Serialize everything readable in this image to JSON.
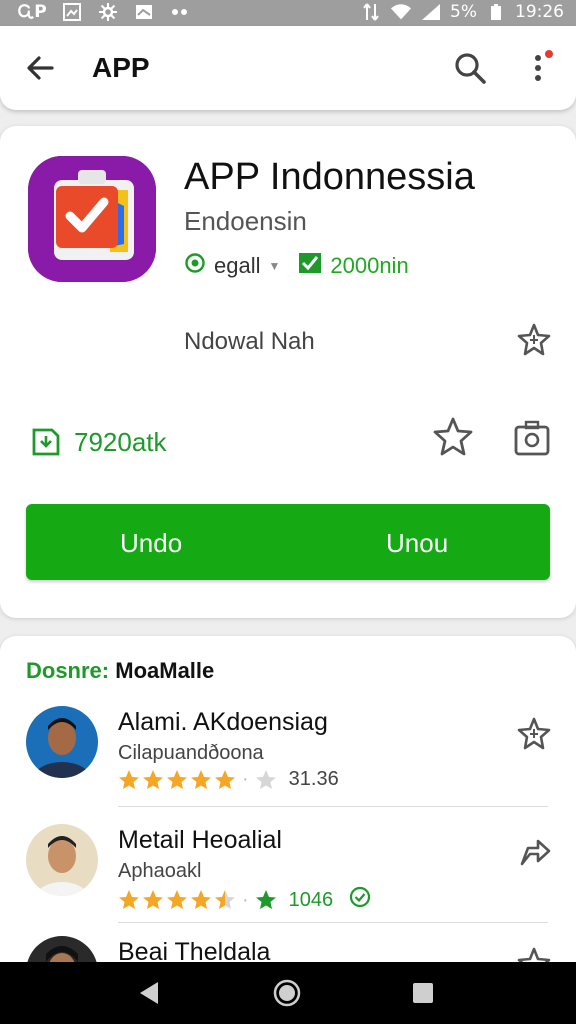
{
  "status_bar": {
    "left_icons": [
      "carrier-logo-icon",
      "image-icon",
      "settings-icon",
      "mail-icon",
      "more-dots-icon"
    ],
    "carrier_label": "ᏩP",
    "right_icons": [
      "data-icon",
      "wifi-icon",
      "signal-icon"
    ],
    "battery": "5%",
    "time": "19:26"
  },
  "appbar": {
    "title": "APP"
  },
  "app": {
    "name": "APP Indonnessia",
    "subtitle": "Endoensin",
    "meta_left": "egall",
    "meta_right": "2000nin",
    "mid_label": "Ndowal Nah",
    "downloads": "7920atk",
    "button_left": "Undo",
    "button_right": "Unou",
    "icon_colors": {
      "bg": "#8a1aa8",
      "tile": "#e84a2a",
      "accent": "#2b6ee8"
    }
  },
  "list": {
    "heading_green": "Dosnre:",
    "heading_dark": "MoaMalle",
    "items": [
      {
        "name": "Alami. AKdoensiag",
        "sub": "Cilapuandðoona",
        "stars": 5,
        "rating": "31.36",
        "rating_color": "gray"
      },
      {
        "name": "Metail Heoalial",
        "sub": "Aphaoakl",
        "stars": 4.5,
        "rating": "1046",
        "rating_color": "green"
      },
      {
        "name": "Beai Theldala",
        "sub": "",
        "stars": 0,
        "rating": "",
        "rating_color": "gray"
      }
    ]
  },
  "colors": {
    "accent_green": "#15aa14",
    "text_green": "#1e9a2a",
    "star_orange": "#f5a623",
    "notification_dot": "#e53935"
  }
}
